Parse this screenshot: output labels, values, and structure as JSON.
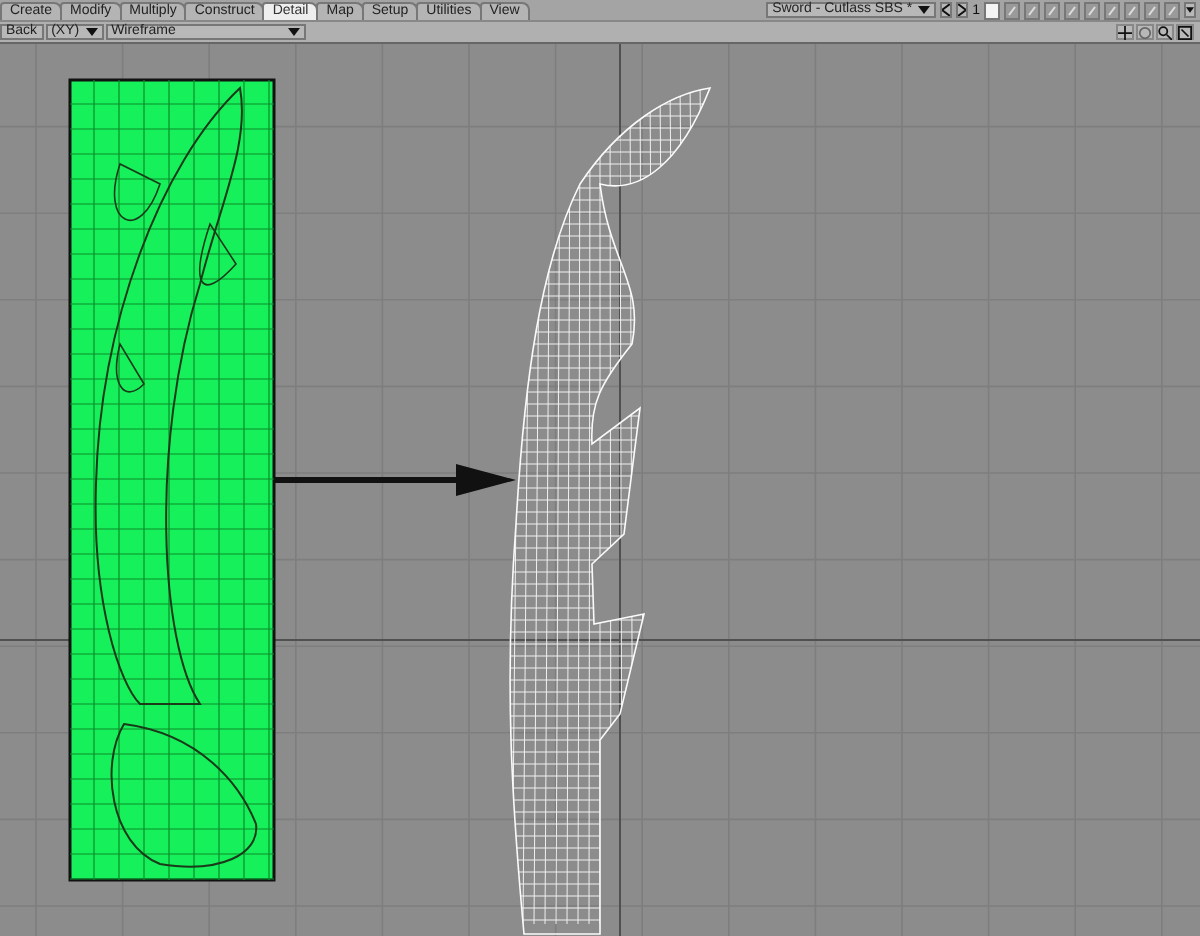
{
  "tabs": [
    {
      "label": "Create",
      "selected": false
    },
    {
      "label": "Modify",
      "selected": false
    },
    {
      "label": "Multiply",
      "selected": false
    },
    {
      "label": "Construct",
      "selected": false
    },
    {
      "label": "Detail",
      "selected": true
    },
    {
      "label": "Map",
      "selected": false
    },
    {
      "label": "Setup",
      "selected": false
    },
    {
      "label": "Utilities",
      "selected": false
    },
    {
      "label": "View",
      "selected": false
    }
  ],
  "object_menu": {
    "value": "Sword - Cutlass SBS *"
  },
  "layer_label": "1",
  "layers": [
    {
      "selected": true
    },
    {
      "selected": false
    },
    {
      "selected": false
    },
    {
      "selected": false
    },
    {
      "selected": false
    },
    {
      "selected": false
    },
    {
      "selected": false
    },
    {
      "selected": false
    },
    {
      "selected": false
    },
    {
      "selected": false
    }
  ],
  "viewport": {
    "view": "Back",
    "axis": "(XY)",
    "mode": "Wireframe"
  }
}
